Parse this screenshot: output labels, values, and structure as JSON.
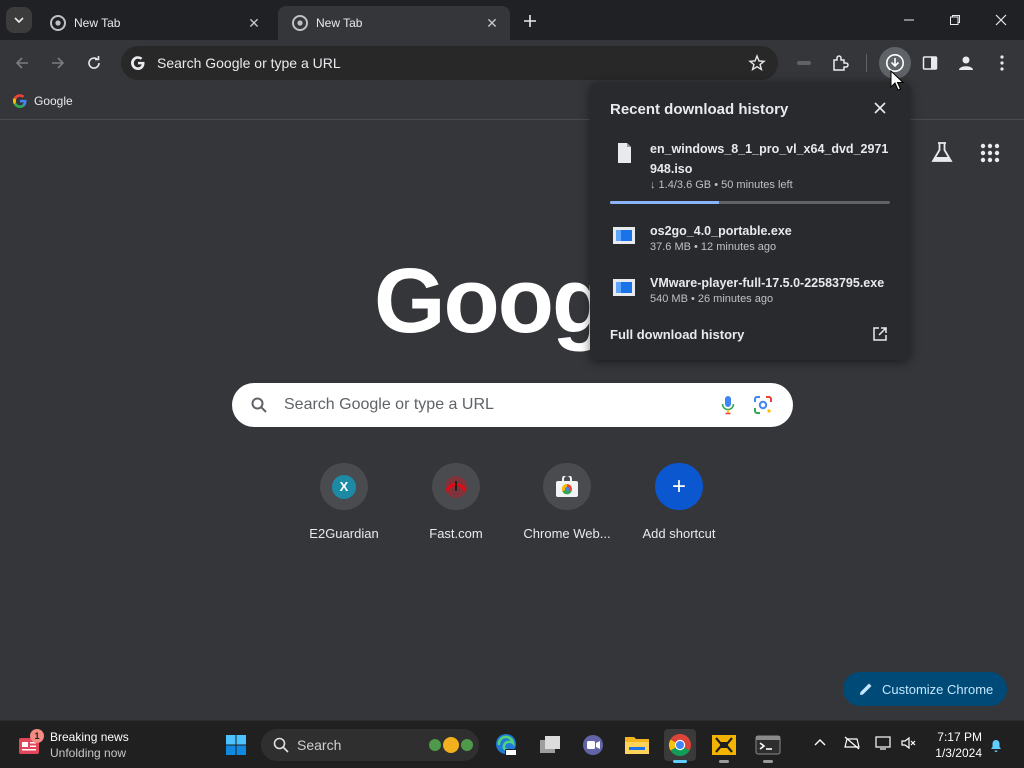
{
  "tabs": [
    {
      "title": "New Tab",
      "active": false
    },
    {
      "title": "New Tab",
      "active": true
    }
  ],
  "toolbar": {
    "omnibox_placeholder": "Search Google or type a URL"
  },
  "bookmarks": [
    {
      "label": "Google",
      "icon": "google-g-icon"
    }
  ],
  "ntp": {
    "logo_text": "Goog",
    "search_placeholder": "Search Google or type a URL",
    "shortcuts": [
      {
        "label": "E2Guardian",
        "icon": "e2guardian-icon",
        "glyph": "X"
      },
      {
        "label": "Fast.com",
        "icon": "speedometer-icon"
      },
      {
        "label": "Chrome Web...",
        "icon": "chrome-web-store-icon"
      },
      {
        "label": "Add shortcut",
        "icon": "plus-icon",
        "glyph": "+"
      }
    ],
    "customize_label": "Customize Chrome"
  },
  "downloads": {
    "title": "Recent download history",
    "items": [
      {
        "name": "en_windows_8_1_pro_vl_x64_dvd_2971948.iso",
        "meta": "↓ 1.4/3.6 GB • 50 minutes left",
        "icon": "file-icon",
        "progress": 0.39
      },
      {
        "name": "os2go_4.0_portable.exe",
        "meta": "37.6 MB • 12 minutes ago",
        "icon": "exe-icon"
      },
      {
        "name": "VMware-player-full-17.5.0-22583795.exe",
        "meta": "540 MB • 26 minutes ago",
        "icon": "exe-icon"
      }
    ],
    "full_history_label": "Full download history"
  },
  "taskbar": {
    "news_badge": "1",
    "news_title": "Breaking news",
    "news_subtitle": "Unfolding now",
    "search_label": "Search",
    "clock_time": "7:17 PM",
    "clock_date": "1/3/2024"
  },
  "colors": {
    "accent_blue": "#8ab4f8",
    "customize_bg": "#004a77",
    "taskbar_active": "#60cdff"
  }
}
